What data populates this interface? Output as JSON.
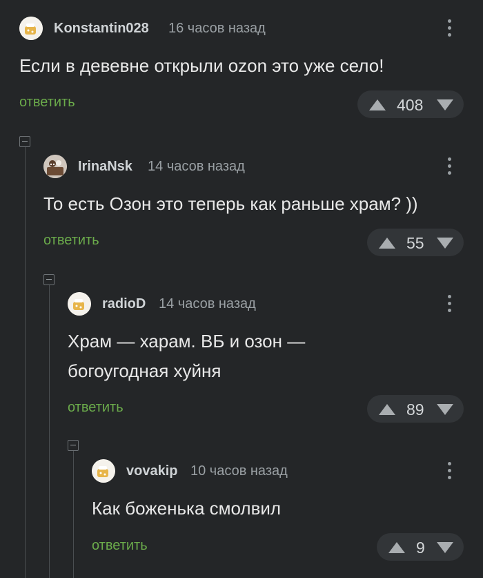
{
  "comments": [
    {
      "author": "Konstantin028",
      "time": "16 часов назад",
      "text": "Если в девевне открыли ozon это уже село!",
      "reply_label": "ответить",
      "votes": "408"
    },
    {
      "author": "IrinaNsk",
      "time": "14 часов назад",
      "text": "То есть Озон это теперь как раньше храм? ))",
      "reply_label": "ответить",
      "votes": "55"
    },
    {
      "author": "radioD",
      "time": "14 часов назад",
      "text_line1": "Храм — харам. ВБ и озон —",
      "text_line2": "богоугодная хуйня",
      "reply_label": "ответить",
      "votes": "89"
    },
    {
      "author": "vovakip",
      "time": "10 часов назад",
      "text": "Как боженька смолвил",
      "reply_label": "ответить",
      "votes": "9"
    }
  ],
  "colors": {
    "background": "#242628",
    "reply_link": "#6bab4b",
    "vote_pill": "#323538"
  }
}
